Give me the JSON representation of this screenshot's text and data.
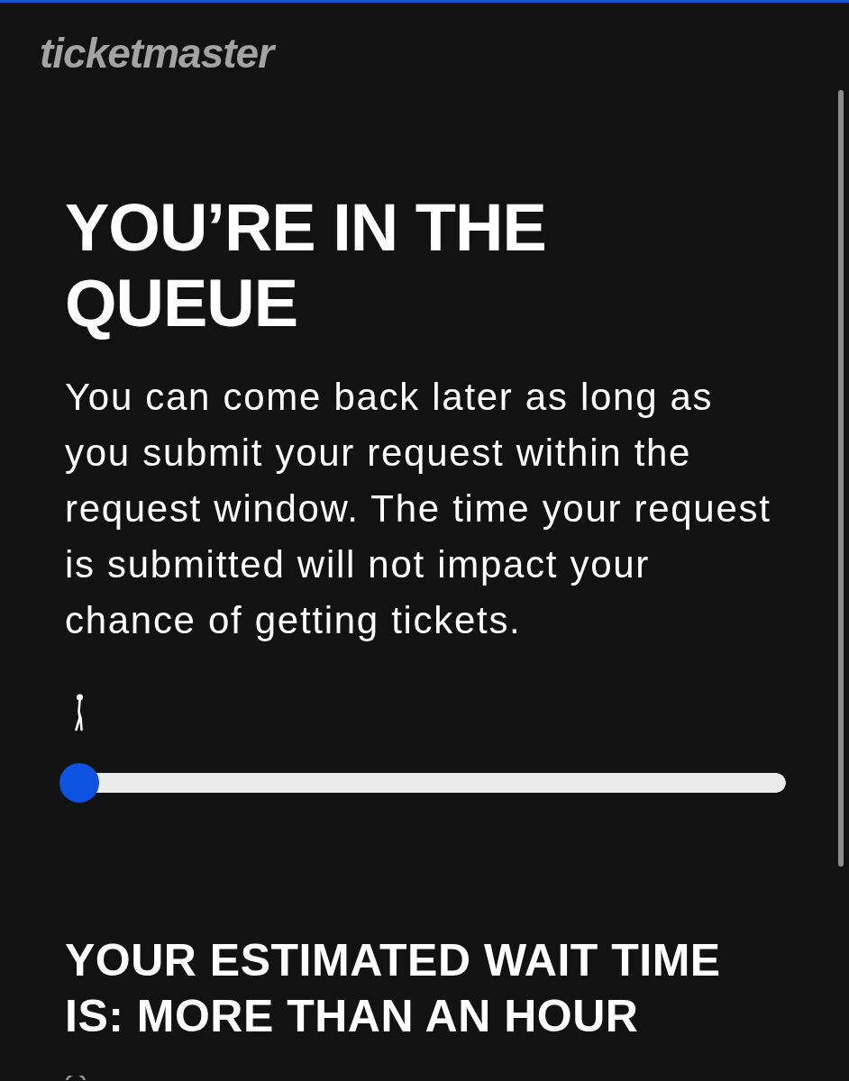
{
  "logo": {
    "text": "ticketmaster"
  },
  "queue": {
    "title": "YOU’RE IN THE QUEUE",
    "message": "You can come back later as long as you submit your request within the request window. The time your request is submitted will not impact your chance of getting tickets.",
    "progress": {
      "level": 0
    }
  },
  "wait": {
    "title": "YOUR ESTIMATED WAIT TIME IS: MORE THAN AN HOUR"
  }
}
